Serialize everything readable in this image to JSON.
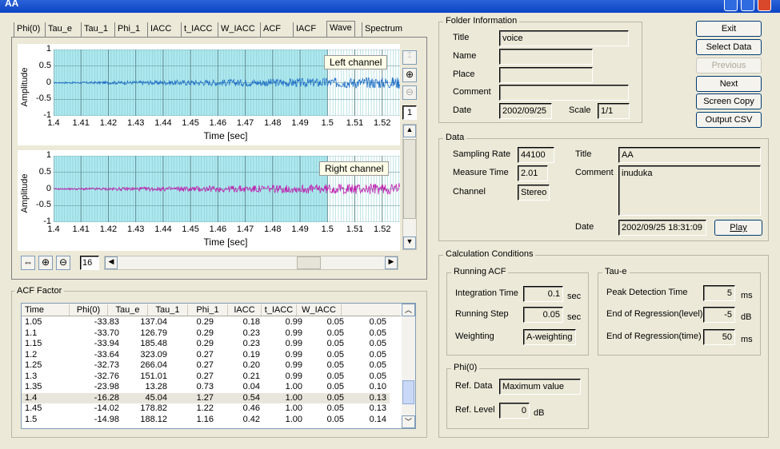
{
  "window": {
    "title": "AA"
  },
  "tabs": [
    "Phi(0)",
    "Tau_e",
    "Tau_1",
    "Phi_1",
    "IACC",
    "t_IACC",
    "W_IACC",
    "ACF",
    "IACF",
    "Wave",
    "Spectrum"
  ],
  "active_tab": "Wave",
  "plots": {
    "ylabel": "Amplitude",
    "xlabel": "Time [sec]",
    "xticks": [
      "1.4",
      "1.41",
      "1.42",
      "1.43",
      "1.44",
      "1.45",
      "1.46",
      "1.47",
      "1.48",
      "1.49",
      "1.5",
      "1.51",
      "1.52"
    ],
    "yticks": [
      "1",
      "0.5",
      "0",
      "-0.5",
      "-1"
    ],
    "left_label": "Left channel",
    "right_label": "Right channel",
    "left_color": "#1f6fc8",
    "right_color": "#c020b0",
    "selection_end": 1.5
  },
  "zoom": {
    "side_value": "1",
    "scroll_value": "16"
  },
  "folder": {
    "title": "Folder Information",
    "title_label": "Title",
    "title_value": "voice",
    "name_label": "Name",
    "name_value": "",
    "place_label": "Place",
    "place_value": "",
    "comment_label": "Comment",
    "comment_value": "",
    "date_label": "Date",
    "date_value": "2002/09/25",
    "scale_label": "Scale",
    "scale_value": "1/1"
  },
  "buttons": {
    "exit": "Exit",
    "select": "Select Data",
    "previous": "Previous",
    "next": "Next",
    "copy": "Screen Copy",
    "csv": "Output CSV",
    "play": "Play"
  },
  "data": {
    "title": "Data",
    "sr_label": "Sampling Rate",
    "sr_value": "44100",
    "mt_label": "Measure Time",
    "mt_value": "2.01",
    "ch_label": "Channel",
    "ch_value": "Stereo",
    "title_label": "Title",
    "title_value": "AA",
    "comment_label": "Comment",
    "comment_value": "inuduka",
    "date_label": "Date",
    "date_value": "2002/09/25 18:31:09"
  },
  "calc": {
    "title": "Calculation Conditions",
    "running_acf": {
      "title": "Running ACF",
      "it_label": "Integration Time",
      "it_value": "0.1",
      "it_unit": "sec",
      "rs_label": "Running Step",
      "rs_value": "0.05",
      "rs_unit": "sec",
      "w_label": "Weighting",
      "w_value": "A-weighting"
    },
    "taue": {
      "title": "Tau-e",
      "pd_label": "Peak Detection Time",
      "pd_value": "5",
      "pd_unit": "ms",
      "el_label": "End of Regression(level)",
      "el_value": "-5",
      "el_unit": "dB",
      "et_label": "End of Regression(time)",
      "et_value": "50",
      "et_unit": "ms"
    },
    "phi0": {
      "title": "Phi(0)",
      "rd_label": "Ref. Data",
      "rd_value": "Maximum value",
      "rl_label": "Ref. Level",
      "rl_value": "0",
      "rl_unit": "dB"
    }
  },
  "acf": {
    "title": "ACF Factor",
    "columns": [
      "Time",
      "Phi(0)",
      "Tau_e",
      "Tau_1",
      "Phi_1",
      "IACC",
      "t_IACC",
      "W_IACC"
    ],
    "rows": [
      [
        "1.05",
        "-33.83",
        "137.04",
        "0.29",
        "0.18",
        "0.99",
        "0.05",
        "0.05"
      ],
      [
        "1.1",
        "-33.70",
        "126.79",
        "0.29",
        "0.23",
        "0.99",
        "0.05",
        "0.05"
      ],
      [
        "1.15",
        "-33.94",
        "185.48",
        "0.29",
        "0.23",
        "0.99",
        "0.05",
        "0.05"
      ],
      [
        "1.2",
        "-33.64",
        "323.09",
        "0.27",
        "0.19",
        "0.99",
        "0.05",
        "0.05"
      ],
      [
        "1.25",
        "-32.73",
        "266.04",
        "0.27",
        "0.20",
        "0.99",
        "0.05",
        "0.05"
      ],
      [
        "1.3",
        "-32.76",
        "151.01",
        "0.27",
        "0.21",
        "0.99",
        "0.05",
        "0.05"
      ],
      [
        "1.35",
        "-23.98",
        "13.28",
        "0.73",
        "0.04",
        "1.00",
        "0.05",
        "0.10"
      ],
      [
        "1.4",
        "-16.28",
        "45.04",
        "1.27",
        "0.54",
        "1.00",
        "0.05",
        "0.13"
      ],
      [
        "1.45",
        "-14.02",
        "178.82",
        "1.22",
        "0.46",
        "1.00",
        "0.05",
        "0.13"
      ],
      [
        "1.5",
        "-14.98",
        "188.12",
        "1.16",
        "0.42",
        "1.00",
        "0.05",
        "0.14"
      ]
    ],
    "selected_row": 7
  }
}
